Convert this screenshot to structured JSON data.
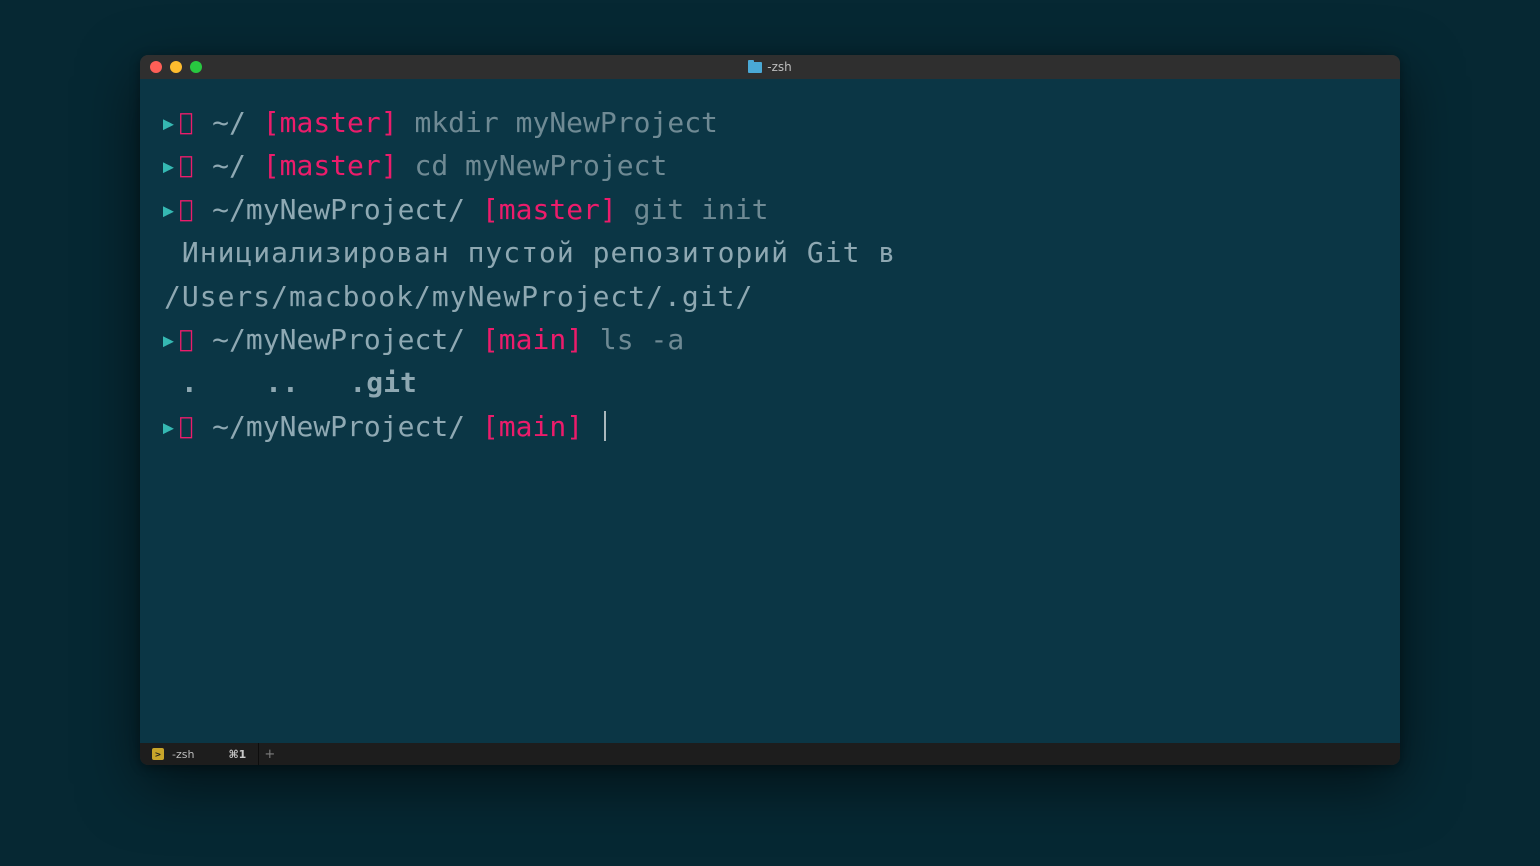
{
  "window": {
    "title": "-zsh"
  },
  "prompt_symbols": {
    "arrow": "▸",
    "apple": ""
  },
  "lines": [
    {
      "type": "prompt",
      "path": "~/",
      "branch": "[master]",
      "command": "mkdir myNewProject"
    },
    {
      "type": "prompt",
      "path": "~/",
      "branch": "[master]",
      "command": "cd myNewProject"
    },
    {
      "type": "prompt",
      "path": "~/myNewProject/",
      "branch": "[master]",
      "command": "git init"
    },
    {
      "type": "output",
      "text": "Инициализирован пустой репозиторий Git в /Users/macbook/myNewProject/.git/"
    },
    {
      "type": "prompt",
      "path": "~/myNewProject/",
      "branch": "[main]",
      "command": "ls -a"
    },
    {
      "type": "ls",
      "text": ".    ..   .git"
    },
    {
      "type": "prompt",
      "path": "~/myNewProject/",
      "branch": "[main]",
      "command": "",
      "cursor": true
    }
  ],
  "tab": {
    "name": "-zsh",
    "shortcut": "⌘1",
    "add": "+"
  }
}
